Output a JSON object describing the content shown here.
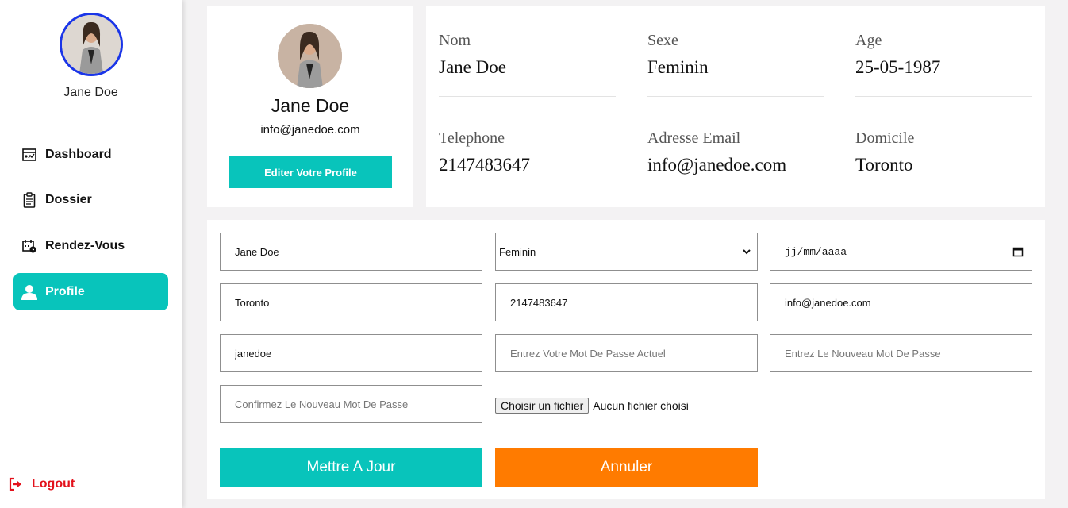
{
  "sidebar": {
    "user_name": "Jane Doe",
    "items": [
      {
        "label": "Dashboard",
        "icon": "dashboard-icon"
      },
      {
        "label": "Dossier",
        "icon": "clipboard-icon"
      },
      {
        "label": "Rendez-Vous",
        "icon": "calendar-icon"
      },
      {
        "label": "Profile",
        "icon": "user-icon"
      }
    ],
    "logout_label": "Logout"
  },
  "profile_card": {
    "name": "Jane Doe",
    "email": "info@janedoe.com",
    "edit_button": "Editer Votre Profile"
  },
  "info": {
    "nom": {
      "label": "Nom",
      "value": "Jane Doe"
    },
    "sexe": {
      "label": "Sexe",
      "value": "Feminin"
    },
    "age": {
      "label": "Age",
      "value": "25-05-1987"
    },
    "telephone": {
      "label": "Telephone",
      "value": "2147483647"
    },
    "email": {
      "label": "Adresse Email",
      "value": "info@janedoe.com"
    },
    "domicile": {
      "label": "Domicile",
      "value": "Toronto"
    }
  },
  "form": {
    "name_value": "Jane Doe",
    "sex_selected": "Feminin",
    "date_placeholder": "jj/mm/aaaa",
    "city_value": "Toronto",
    "phone_value": "2147483647",
    "email_value": "info@janedoe.com",
    "username_value": "janedoe",
    "current_password_placeholder": "Entrez Votre Mot De Passe Actuel",
    "new_password_placeholder": "Entrez Le Nouveau Mot De Passe",
    "confirm_password_placeholder": "Confirmez Le Nouveau Mot De Passe",
    "file_button": "Choisir un fichier",
    "file_status": "Aucun fichier choisi",
    "update_button": "Mettre A Jour",
    "cancel_button": "Annuler"
  },
  "colors": {
    "accent": "#08c4bb",
    "cancel": "#ff7b00",
    "logout": "#e3111b",
    "avatar_border": "#1a35e8"
  }
}
